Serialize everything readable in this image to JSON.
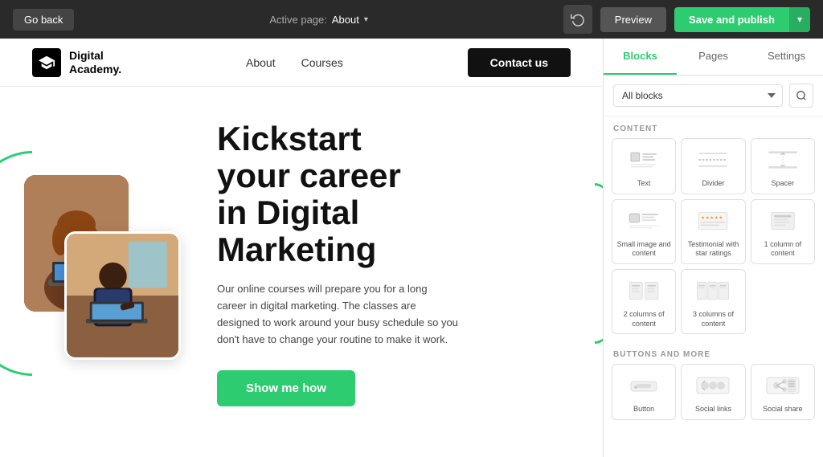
{
  "topbar": {
    "go_back_label": "Go back",
    "active_page_prefix": "Active page:",
    "active_page_name": "About",
    "history_icon": "↺",
    "preview_label": "Preview",
    "save_publish_label": "Save and publish",
    "arrow_icon": "▾"
  },
  "site": {
    "logo_icon": "🎓",
    "logo_line1": "Digital",
    "logo_line2": "Academy.",
    "nav_links": [
      {
        "label": "About"
      },
      {
        "label": "Courses"
      }
    ],
    "contact_label": "Contact us"
  },
  "hero": {
    "title_line1": "Kickstart",
    "title_line2": "your career",
    "title_line3": "in Digital",
    "title_line4": "Marketing",
    "description": "Our online courses will prepare you for a long career in digital marketing. The classes are designed to work around your busy schedule so you don't have to change your routine to make it work.",
    "cta_label": "Show me how"
  },
  "panel": {
    "tabs": [
      {
        "label": "Blocks",
        "active": true
      },
      {
        "label": "Pages",
        "active": false
      },
      {
        "label": "Settings",
        "active": false
      }
    ],
    "filter_options": [
      "All blocks"
    ],
    "filter_placeholder": "All blocks",
    "search_icon": "⌕",
    "sections": [
      {
        "label": "CONTENT",
        "blocks": [
          {
            "id": "text",
            "label": "Text"
          },
          {
            "id": "divider",
            "label": "Divider"
          },
          {
            "id": "spacer",
            "label": "Spacer"
          },
          {
            "id": "small-image-content",
            "label": "Small image and content"
          },
          {
            "id": "testimonial-star",
            "label": "Testimonial with star ratings"
          },
          {
            "id": "1col",
            "label": "1 column of content"
          },
          {
            "id": "2col",
            "label": "2 columns of content"
          },
          {
            "id": "3col",
            "label": "3 columns of content"
          }
        ]
      },
      {
        "label": "BUTTONS AND MORE",
        "blocks": [
          {
            "id": "button",
            "label": "Button"
          },
          {
            "id": "social-links",
            "label": "Social links"
          },
          {
            "id": "social-share",
            "label": "Social share"
          }
        ]
      }
    ]
  }
}
